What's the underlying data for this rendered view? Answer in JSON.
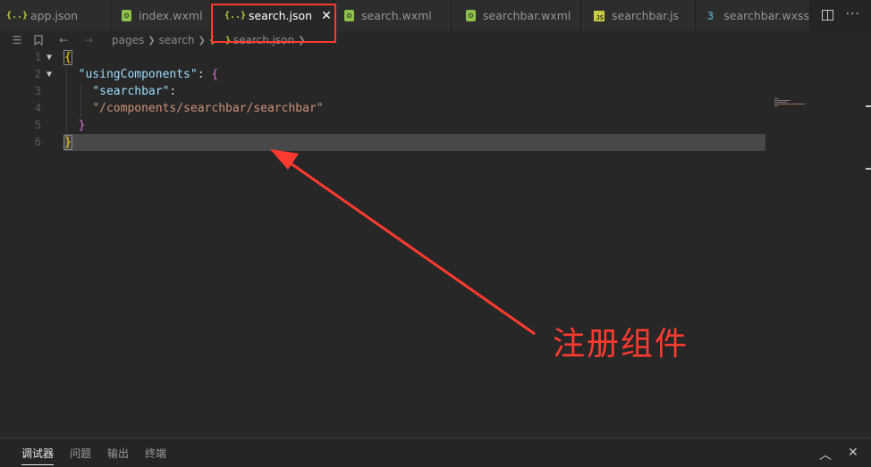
{
  "tabs": [
    {
      "label": "app.json",
      "icon": "json-braces-icon",
      "active": false
    },
    {
      "label": "index.wxml",
      "icon": "wxml-file-icon",
      "active": false
    },
    {
      "label": "search.json",
      "icon": "json-braces-icon",
      "active": true
    },
    {
      "label": "search.wxml",
      "icon": "wxml-file-icon",
      "active": false
    },
    {
      "label": "searchbar.wxml",
      "icon": "wxml-file-icon",
      "active": false
    },
    {
      "label": "searchbar.js",
      "icon": "js-file-icon",
      "active": false
    },
    {
      "label": "searchbar.wxss",
      "icon": "css-file-icon",
      "active": false
    }
  ],
  "tab_close_glyph": "✕",
  "json_icon_glyph": "{..}",
  "js_icon_glyph": "JS",
  "css_icon_glyph": "3",
  "breadcrumb": {
    "items": [
      "pages",
      "search",
      "search.json"
    ]
  },
  "editor": {
    "line_numbers": [
      "1",
      "2",
      "3",
      "4",
      "5",
      "6"
    ],
    "lines": [
      {
        "open_brace": "{"
      },
      {
        "key": "\"usingComponents\"",
        "colon": ": ",
        "brace": "{"
      },
      {
        "key": "\"searchbar\"",
        "colon": ":"
      },
      {
        "value": "\"/components/searchbar/searchbar\""
      },
      {
        "brace": "}"
      },
      {
        "close_brace": "}"
      }
    ]
  },
  "annotation": {
    "text": "注册组件",
    "color": "#ff3b30"
  },
  "panel": {
    "tabs": [
      "调试器",
      "问题",
      "输出",
      "终端"
    ]
  },
  "colors": {
    "background": "#272727",
    "tabbar": "#252526",
    "json_key": "#9cdcfe",
    "json_string": "#ce9178",
    "brace_level1": "#ffd700",
    "brace_level2": "#da70d6"
  }
}
